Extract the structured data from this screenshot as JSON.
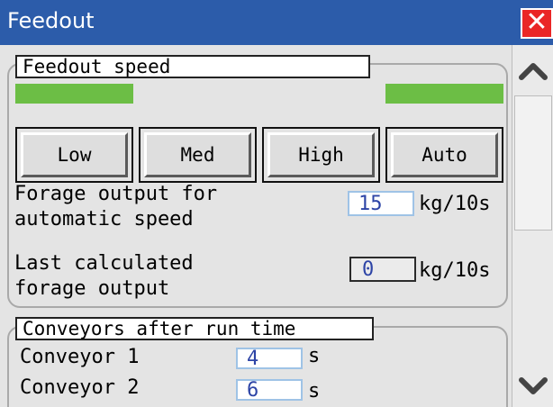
{
  "window": {
    "title": "Feedout"
  },
  "feedout_speed": {
    "legend": "Feedout speed",
    "buttons": [
      {
        "label": "Low",
        "active": true
      },
      {
        "label": "Med",
        "active": false
      },
      {
        "label": "High",
        "active": false
      },
      {
        "label": "Auto",
        "active": true
      }
    ],
    "indicator_color": "#6cbe45",
    "forage_output_auto": {
      "label_line1": "Forage output for",
      "label_line2": "automatic speed",
      "value": "15",
      "unit": "kg/10s"
    },
    "last_calculated": {
      "label_line1": "Last calculated",
      "label_line2": "forage output",
      "value": "0",
      "unit": "kg/10s"
    }
  },
  "conveyors": {
    "legend": "Conveyors after run time",
    "items": [
      {
        "label": "Conveyor 1",
        "value": "4",
        "unit": "s"
      },
      {
        "label": "Conveyor 2",
        "value": "6",
        "unit": "s"
      }
    ]
  },
  "colors": {
    "titlebar": "#2c5caa",
    "close": "#ea2626",
    "value_text": "#2d44a6"
  }
}
